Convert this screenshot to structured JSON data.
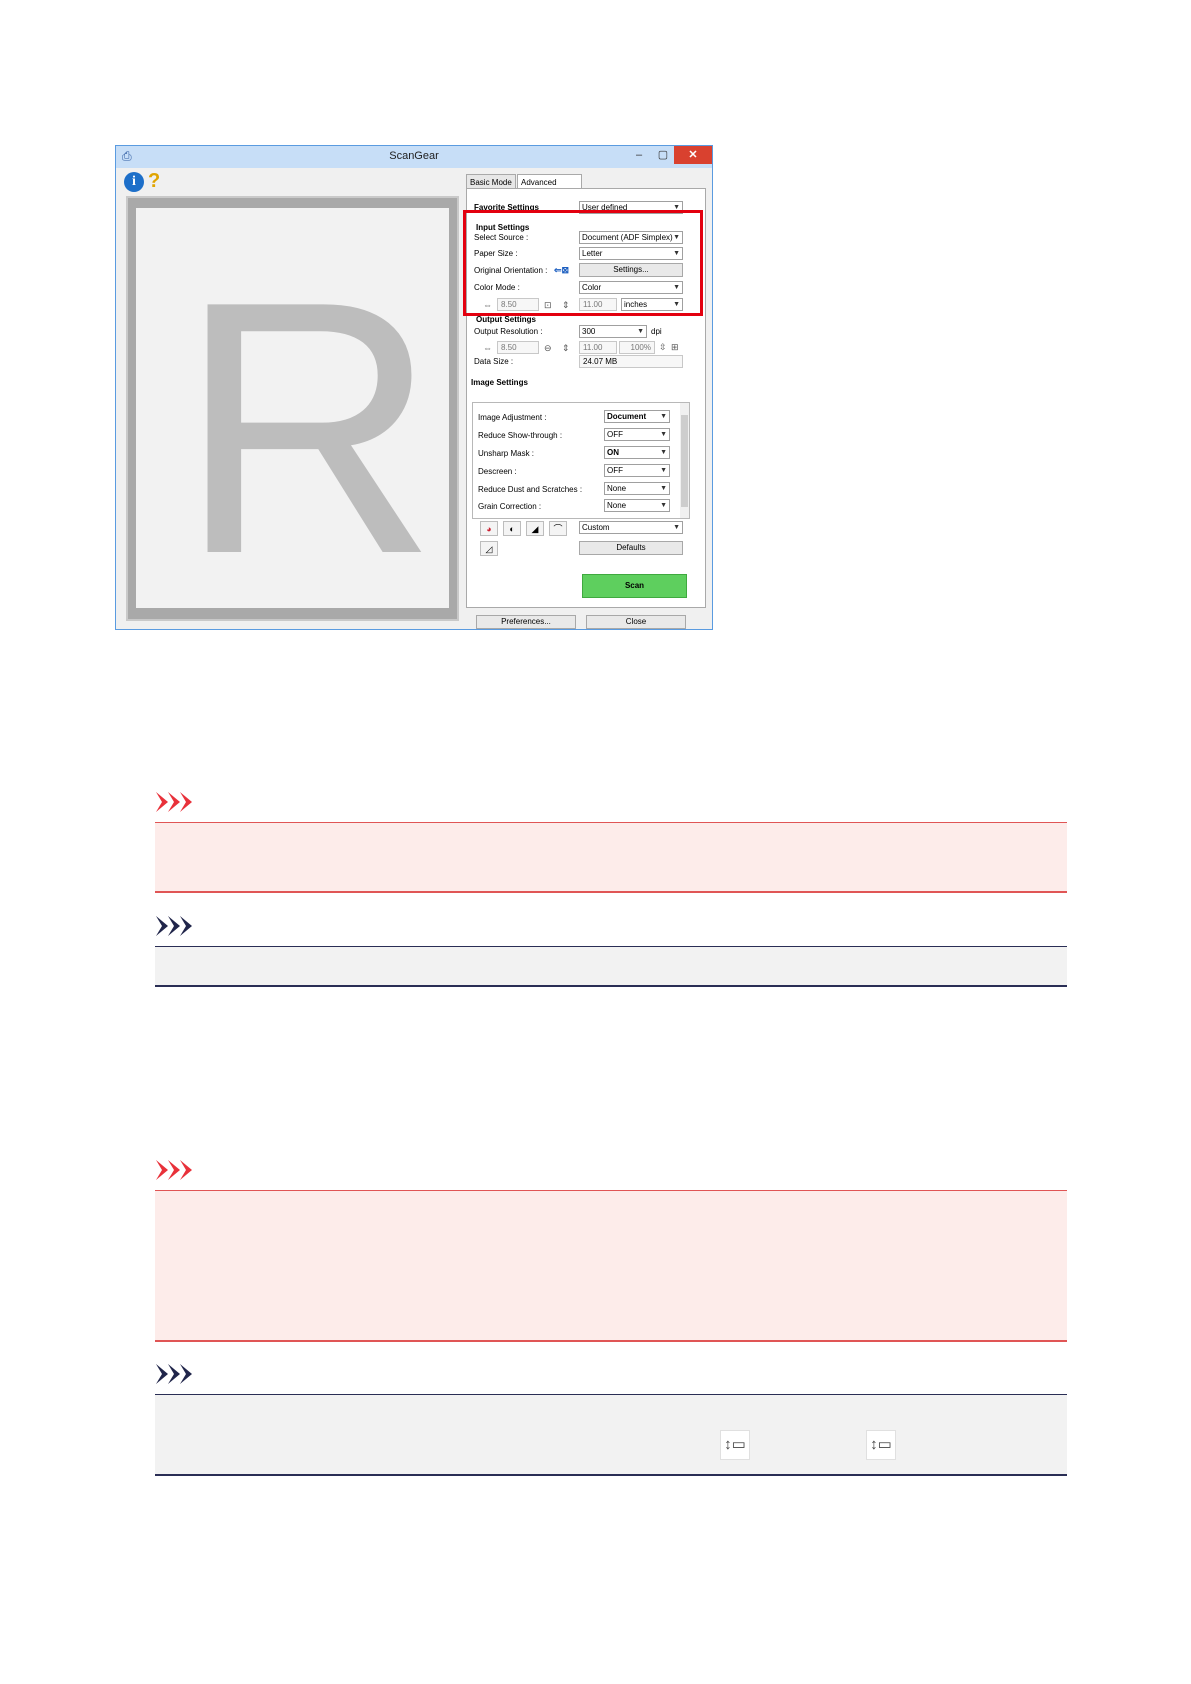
{
  "window": {
    "title": "ScanGear",
    "controls": {
      "minimize": "–",
      "maximize": "▢",
      "close": "✕"
    }
  },
  "preview": {
    "letter": "R"
  },
  "tabs": {
    "basic": "Basic Mode",
    "advanced": "Advanced Mode"
  },
  "favorite": {
    "label": "Favorite Settings",
    "value": "User defined"
  },
  "input_settings": {
    "heading": "Input Settings",
    "select_source": {
      "label": "Select Source :",
      "value": "Document (ADF Simplex)"
    },
    "paper_size": {
      "label": "Paper Size :",
      "value": "Letter"
    },
    "orientation": {
      "label": "Original Orientation :",
      "button": "Settings..."
    },
    "color_mode": {
      "label": "Color Mode :",
      "value": "Color"
    },
    "width": "8.50",
    "height": "11.00",
    "unit": "inches"
  },
  "output_settings": {
    "heading": "Output Settings",
    "resolution": {
      "label": "Output Resolution :",
      "value": "300",
      "unit": "dpi"
    },
    "width": "8.50",
    "height": "11.00",
    "scale": "100%",
    "data_size": {
      "label": "Data Size :",
      "value": "24.07 MB"
    }
  },
  "image_settings": {
    "heading": "Image Settings",
    "rows": [
      {
        "label": "Image Adjustment :",
        "value": "Document"
      },
      {
        "label": "Reduce Show-through :",
        "value": "OFF"
      },
      {
        "label": "Unsharp Mask :",
        "value": "ON"
      },
      {
        "label": "Descreen :",
        "value": "OFF"
      },
      {
        "label": "Reduce Dust and Scratches :",
        "value": "None"
      },
      {
        "label": "Grain Correction :",
        "value": "None"
      }
    ]
  },
  "tone": {
    "preset": "Custom",
    "defaults_button": "Defaults"
  },
  "buttons": {
    "scan": "Scan",
    "preferences": "Preferences...",
    "close": "Close"
  },
  "colors": {
    "important": "#e8313a",
    "note": "#20254a",
    "scan_green": "#5ecf5e",
    "highlight": "#e3000f"
  }
}
